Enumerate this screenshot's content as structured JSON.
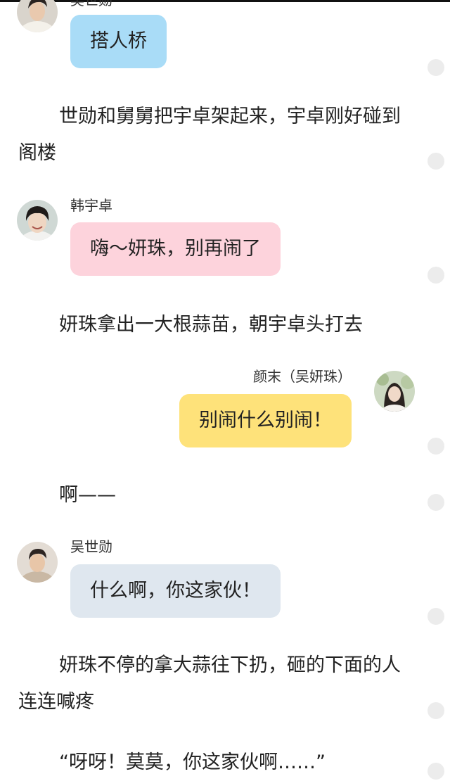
{
  "chat": {
    "msg1": {
      "speaker": "吴世勋",
      "text": "搭人桥"
    },
    "narr1": "世勋和舅舅把宇卓架起来，宇卓刚好碰到阁楼",
    "msg2": {
      "speaker": "韩宇卓",
      "text": "嗨～妍珠，别再闹了"
    },
    "narr2": "妍珠拿出一大根蒜苗，朝宇卓头打去",
    "msg3": {
      "speaker": "颜末（吴妍珠）",
      "text": "别闹什么别闹！"
    },
    "narr3": "啊——",
    "msg4": {
      "speaker": "吴世勋",
      "text": "什么啊，你这家伙！"
    },
    "narr4": "妍珠不停的拿大蒜往下扔，砸的下面的人连连喊疼",
    "narr5": "“呀呀！莫莫，你这家伙啊……”"
  },
  "colors": {
    "bubble_blue": "#a9dcf7",
    "bubble_pink": "#fdd3dc",
    "bubble_yellow": "#fee27a",
    "bubble_gray": "#dfe7ef",
    "side_dot": "#ececec"
  },
  "icons": {
    "avatar1": "avatar-photo-male",
    "avatar2": "avatar-photo-male",
    "avatar3": "avatar-photo-female",
    "avatar4": "avatar-photo-male",
    "side_dot": "circle-dot"
  }
}
